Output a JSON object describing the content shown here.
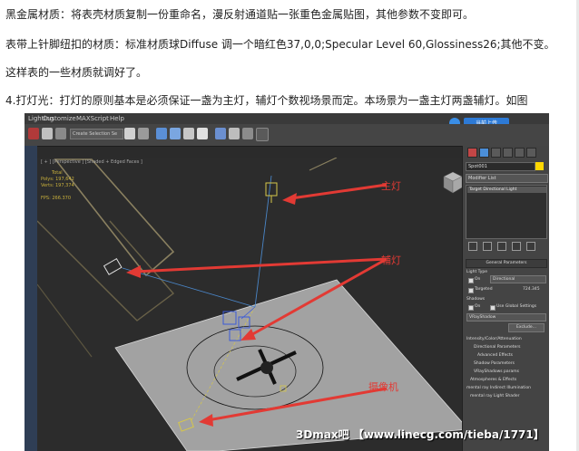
{
  "paragraphs": [
    "黑金属材质：将表壳材质复制一份重命名，漫反射通道贴一张重色金属贴图，其他参数不变即可。",
    "表带上针脚纽扣的材质：标准材质球Diffuse 调一个暗红色37,0,0;Specular Level 60,Glossiness26;其他不变。",
    "这样表的一些材质就调好了。",
    "4.打灯光：打灯的原则基本是必须保证一盏为主灯，辅灯个数视场景而定。本场景为一盏主灯两盏辅灯。如图"
  ],
  "screenshot": {
    "menu": [
      "Lighting",
      "Customize",
      "MAXScript",
      "Help"
    ],
    "upload_button": "当前上传",
    "toolbar_select": "Create Selection Se",
    "viewport": {
      "label": "[ + ] [Perspective ] [Shaded + Edged Faces ]",
      "stats_lines": [
        "Total",
        "Polys:  197,642",
        "Verts:  197,374",
        "",
        "FPS:    266.370"
      ]
    },
    "annotations": {
      "main_light": "主灯",
      "fill_light": "辅灯",
      "camera": "摄像机",
      "color": "#e23a34"
    },
    "command_panel": {
      "object_name": "Spot001",
      "modifier_list": "Modifier List",
      "stack_item": "Target Directional Light",
      "rollouts": {
        "general": "General Parameters",
        "light_type": "Light Type",
        "on": "On",
        "type_value": "Directional",
        "targeted": "Targeted",
        "distance": "724.345",
        "shadows": "Shadows",
        "shadows_on": "On",
        "use_global": "Use Global Settings",
        "shadow_type": "VRayShadow",
        "exclude": "Exclude...",
        "sections": [
          "Intensity/Color/Attenuation",
          "Directional Parameters",
          "Advanced Effects",
          "Shadow Parameters",
          "VRayShadows params",
          "Atmospheres & Effects",
          "mental ray Indirect Illumination",
          "mental ray Light Shader"
        ]
      }
    }
  },
  "watermark": "3Dmax吧 【www.linecg.com/tieba/1771】"
}
